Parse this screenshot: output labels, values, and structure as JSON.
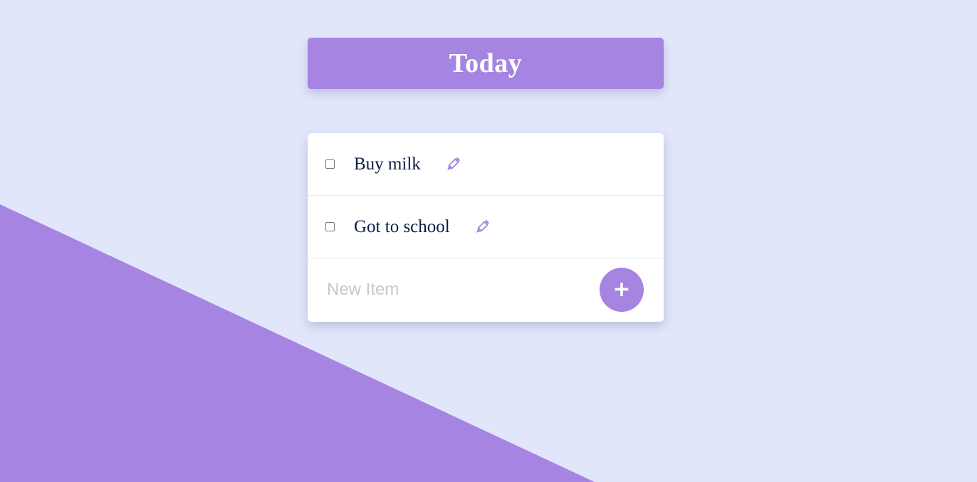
{
  "colors": {
    "background": "#e1e6fb",
    "accent": "#a684e2",
    "text": "#0b1e45",
    "card": "#ffffff"
  },
  "header": {
    "title": "Today"
  },
  "todo": {
    "items": [
      {
        "label": "Buy milk",
        "checked": false,
        "edit_icon": "pencil-icon"
      },
      {
        "label": "Got to school",
        "checked": false,
        "edit_icon": "pencil-icon"
      }
    ],
    "new_item": {
      "value": "",
      "placeholder": "New Item"
    },
    "add_button": {
      "label": "+",
      "icon": "plus-icon"
    }
  }
}
